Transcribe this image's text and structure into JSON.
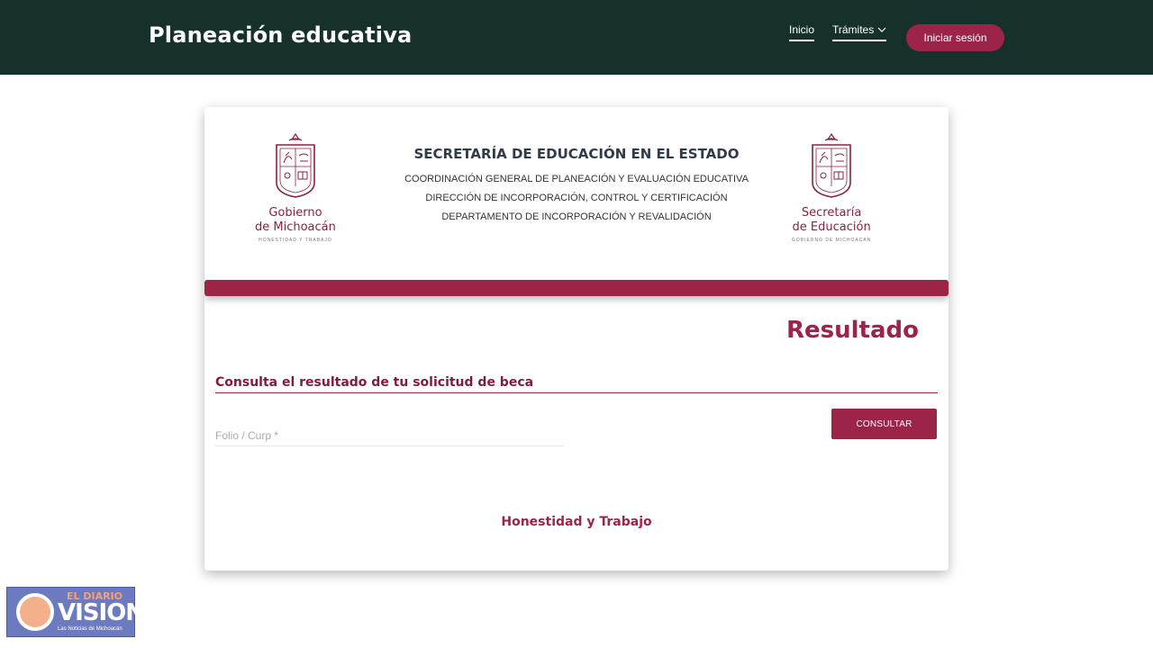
{
  "header": {
    "brand": "Planeación educativa",
    "nav": {
      "inicio": "Inicio",
      "tramites": "Trámites",
      "login": "Iniciar sesión"
    }
  },
  "card": {
    "logo_left": {
      "line1": "Gobierno",
      "line2": "de Michoacán",
      "sub": "HONESTIDAD Y TRABAJO"
    },
    "logo_right": {
      "line1": "Secretaría",
      "line2": "de Educación",
      "sub": "GOBIERNO DE MICHOACÁN"
    },
    "title": "SECRETARÍA DE EDUCACIÓN EN EL ESTADO",
    "lines": [
      "COORDINACIÓN GENERAL DE PLANEACIÓN Y EVALUACIÓN EDUCATIVA",
      "DIRECCIÓN DE INCORPORACIÓN, CONTROL Y CERTIFICACIÓN",
      "DEPARTAMENTO DE INCORPORACIÓN Y REVALIDACIÓN"
    ],
    "result_title": "Resultado",
    "section_title": "Consulta el resultado de tu solicitud de beca",
    "input": {
      "placeholder": "Folio / Curp *",
      "value": ""
    },
    "consult_button": "CONSULTAR",
    "motto": "Honestidad y Trabajo"
  },
  "watermark": {
    "top": "EL DIARIO",
    "main": "VISION",
    "sub": "Las Noticias de Michoacán"
  },
  "colors": {
    "topbar": "#16302b",
    "accent": "#9d2449",
    "accent_dark": "#7c1d40"
  }
}
